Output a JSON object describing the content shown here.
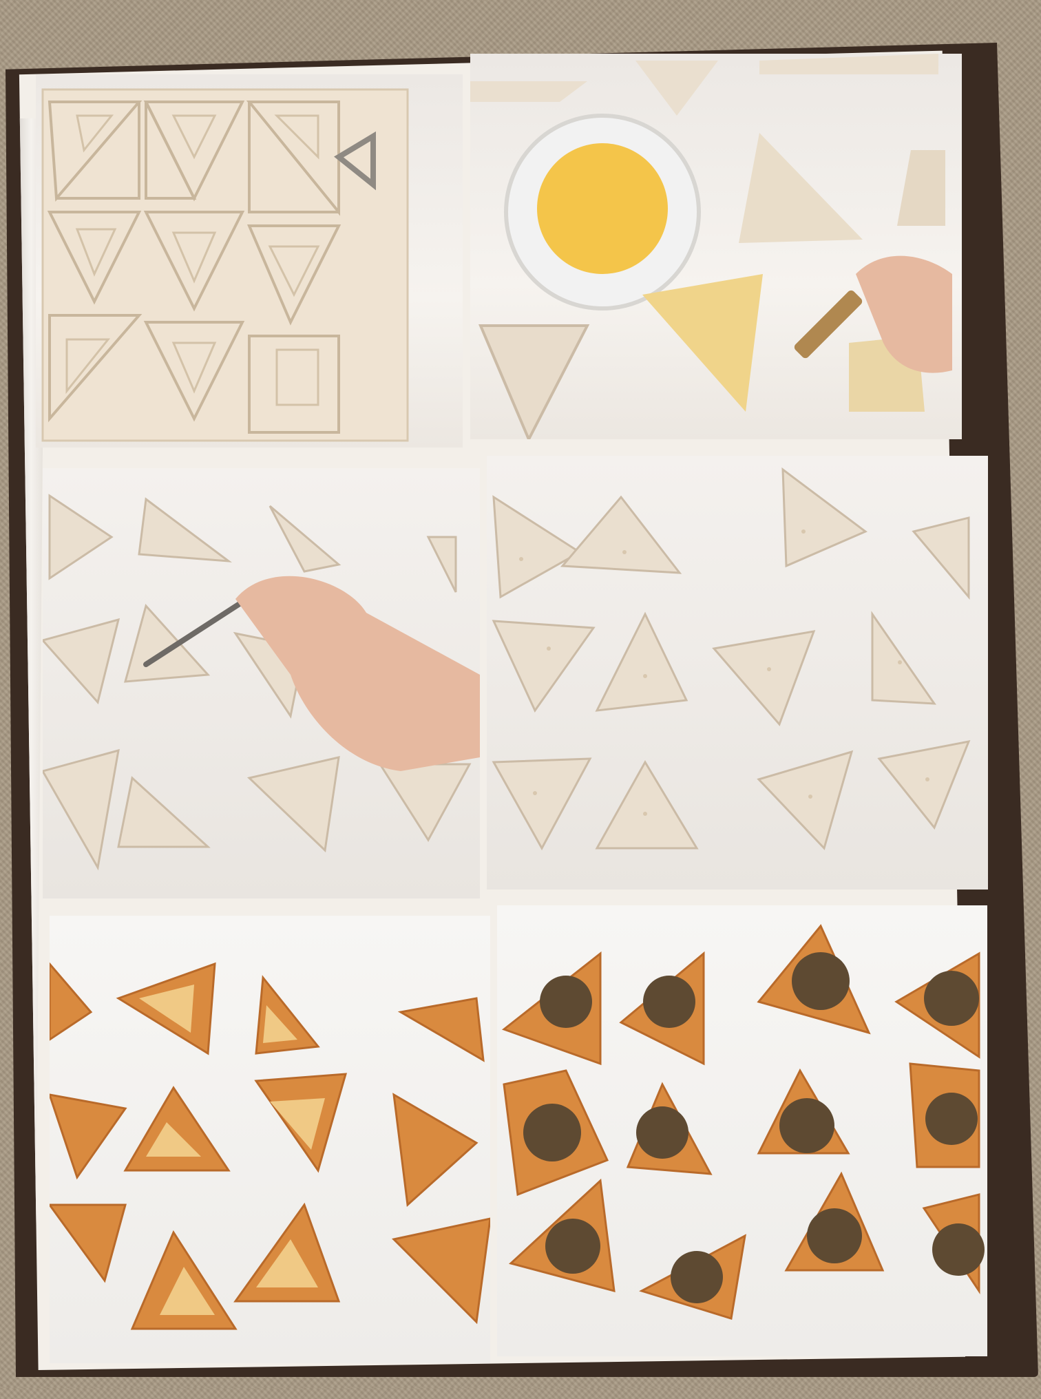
{
  "image": {
    "subject": "",
    "panels": [
      {
        "id": "p1",
        "step": ""
      },
      {
        "id": "p2",
        "step": ""
      },
      {
        "id": "p3",
        "step": ""
      },
      {
        "id": "p4",
        "step": ""
      },
      {
        "id": "p5",
        "step": ""
      },
      {
        "id": "p6",
        "step": ""
      }
    ]
  },
  "colors": {
    "carpet": "#a99a84",
    "book_edge": "#3a2b22",
    "page": "#f3efe9",
    "dough": "#eadfcf",
    "dough_shadow": "#cbbba6",
    "baked": "#d98a3f",
    "baked_light": "#f0c985",
    "filling": "#5e4a32",
    "egg": "#f4c54a",
    "skin": "#e6b9a0"
  }
}
